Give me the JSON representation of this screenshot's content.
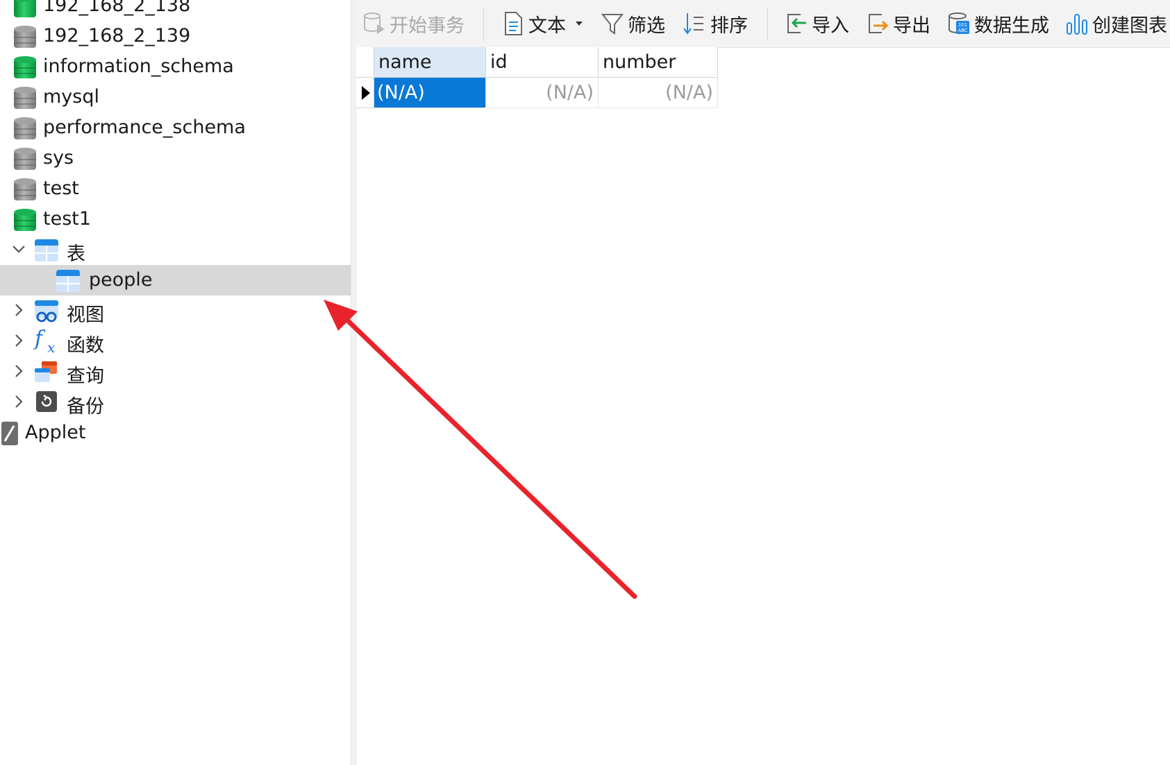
{
  "tree": {
    "connections": [
      {
        "label": "192_168_2_138",
        "color": "green"
      },
      {
        "label": "192_168_2_139",
        "color": "gray"
      }
    ],
    "databases": [
      {
        "label": "information_schema",
        "color": "green"
      },
      {
        "label": "mysql",
        "color": "gray"
      },
      {
        "label": "performance_schema",
        "color": "gray"
      },
      {
        "label": "sys",
        "color": "gray"
      },
      {
        "label": "test",
        "color": "gray"
      },
      {
        "label": "test1",
        "color": "green"
      }
    ],
    "groups": {
      "tables": "表",
      "views": "视图",
      "functions": "函数",
      "queries": "查询",
      "backups": "备份"
    },
    "selected_table": "people",
    "applet": "Applet"
  },
  "toolbar": {
    "begin_transaction": "开始事务",
    "text": "文本",
    "filter": "筛选",
    "sort": "排序",
    "import": "导入",
    "export": "导出",
    "data_generation": "数据生成",
    "create_chart": "创建图表"
  },
  "grid": {
    "columns": [
      "name",
      "id",
      "number"
    ],
    "rows": [
      [
        "(N/A)",
        "(N/A)",
        "(N/A)"
      ]
    ]
  },
  "colors": {
    "selection_blue": "#0a78d7",
    "arrow_red": "#e8232c",
    "db_green": "#19b356",
    "db_gray": "#a3a3a3"
  }
}
